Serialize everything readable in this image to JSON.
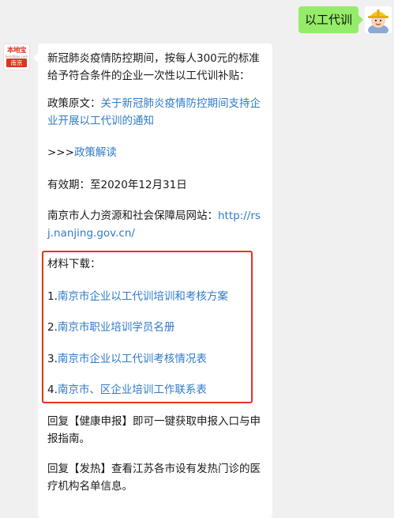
{
  "user_message": {
    "text": "以工代训"
  },
  "bot": {
    "avatar_logo": "本地宝",
    "avatar_domain": "bendibao.com",
    "avatar_city": "南京"
  },
  "message": {
    "intro": "新冠肺炎疫情防控期间，按每人300元的标准给予符合条件的企业一次性以工代训补贴：",
    "policy_label": "政策原文：",
    "policy_link": "关于新冠肺炎疫情防控期间支持企业开展以工代训的通知",
    "interpret_prefix": ">>>",
    "interpret_link": "政策解读",
    "validity": "有效期：至2020年12月31日",
    "website_label": "南京市人力资源和社会保障局网站：",
    "website_link": "http://rsj.nanjing.gov.cn/",
    "download_title": "材料下载：",
    "downloads": [
      {
        "num": "1.",
        "label": "南京市企业以工代训培训和考核方案"
      },
      {
        "num": "2.",
        "label": "南京市职业培训学员名册"
      },
      {
        "num": "3.",
        "label": "南京市企业以工代训考核情况表"
      },
      {
        "num": "4.",
        "label": "南京市、区企业培训工作联系表"
      }
    ],
    "reply_health_prefix": "回复",
    "reply_health_keyword": "【健康申报】",
    "reply_health_suffix": "即可一键获取申报入口与申报指南。",
    "reply_fever_prefix": "回复",
    "reply_fever_keyword": "【发热】",
    "reply_fever_suffix": "查看江苏各市设有发热门诊的医疗机构名单信息。"
  },
  "colors": {
    "background": "#f0f0f0",
    "user_bubble": "#95ec69",
    "link": "#2f7bc9",
    "highlight_border": "#e53222",
    "brand_red": "#d9371d"
  }
}
